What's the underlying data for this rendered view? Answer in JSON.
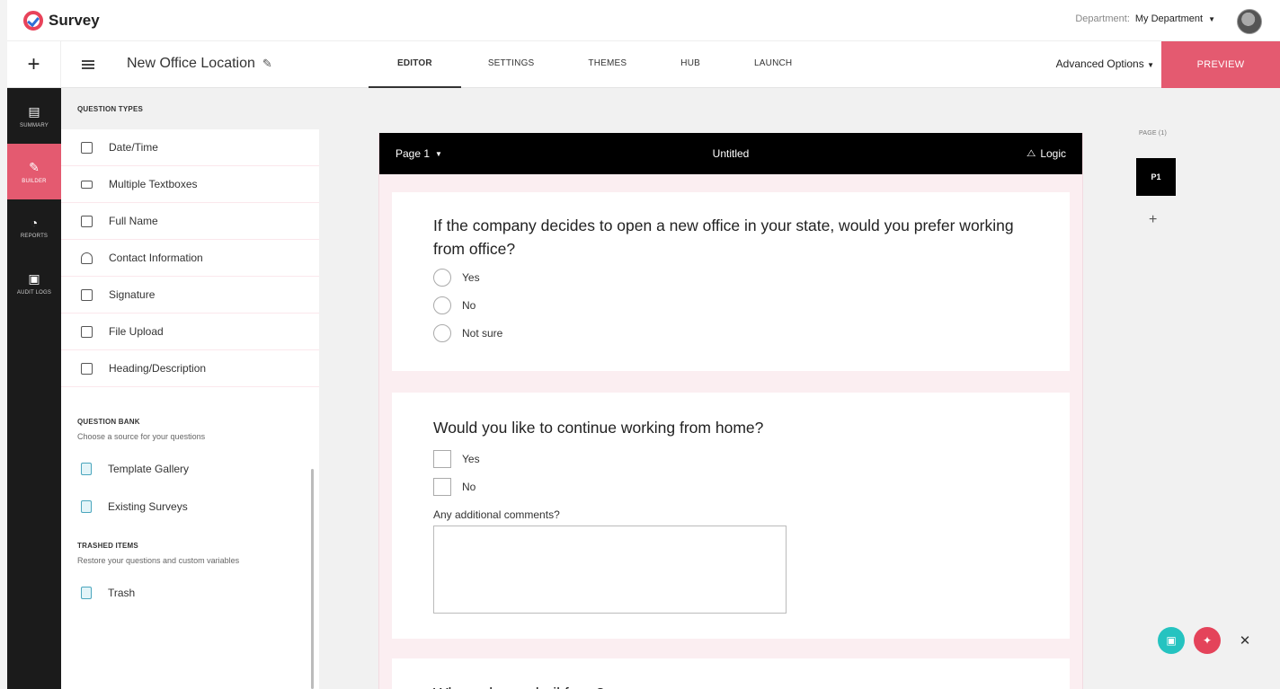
{
  "app": {
    "name": "Survey"
  },
  "header": {
    "department_label": "Department:",
    "department_value": "My Department"
  },
  "toolbar": {
    "survey_title": "New Office Location",
    "tabs": [
      {
        "label": "EDITOR",
        "active": true
      },
      {
        "label": "SETTINGS"
      },
      {
        "label": "THEMES"
      },
      {
        "label": "HUB"
      },
      {
        "label": "LAUNCH"
      }
    ],
    "advanced_options": "Advanced Options",
    "preview": "PREVIEW"
  },
  "rail": [
    {
      "label": "SUMMARY",
      "icon": "summary-icon"
    },
    {
      "label": "BUILDER",
      "icon": "pencil-icon",
      "active": true
    },
    {
      "label": "REPORTS",
      "icon": "pie-chart-icon"
    },
    {
      "label": "AUDIT LOGS",
      "icon": "log-icon"
    }
  ],
  "sidebar": {
    "question_types_heading": "QUESTION TYPES",
    "question_types": [
      "Date/Time",
      "Multiple Textboxes",
      "Full Name",
      "Contact Information",
      "Signature",
      "File Upload",
      "Heading/Description"
    ],
    "question_bank": {
      "title": "QUESTION BANK",
      "subtitle": "Choose a source for your questions",
      "items": [
        "Template Gallery",
        "Existing Surveys"
      ]
    },
    "trashed": {
      "title": "TRASHED ITEMS",
      "subtitle": "Restore your questions and custom variables",
      "items": [
        "Trash"
      ]
    }
  },
  "page": {
    "selector": "Page 1",
    "title": "Untitled",
    "logic": "Logic",
    "questions": [
      {
        "text": "If the company decides to open a new office in your state, would you prefer working from office?",
        "options": [
          "Yes",
          "No",
          "Not sure"
        ]
      },
      {
        "text": "Would you like to continue working from home?",
        "options": [
          "Yes",
          "No"
        ],
        "comment_label": "Any additional comments?"
      },
      {
        "text": "Where do you hail from?"
      }
    ]
  },
  "pages_panel": {
    "label": "PAGE (1)",
    "thumb": "P1"
  },
  "colors": {
    "accent": "#e45a70",
    "teal": "#25c3c0",
    "rail": "#1b1b1b"
  }
}
